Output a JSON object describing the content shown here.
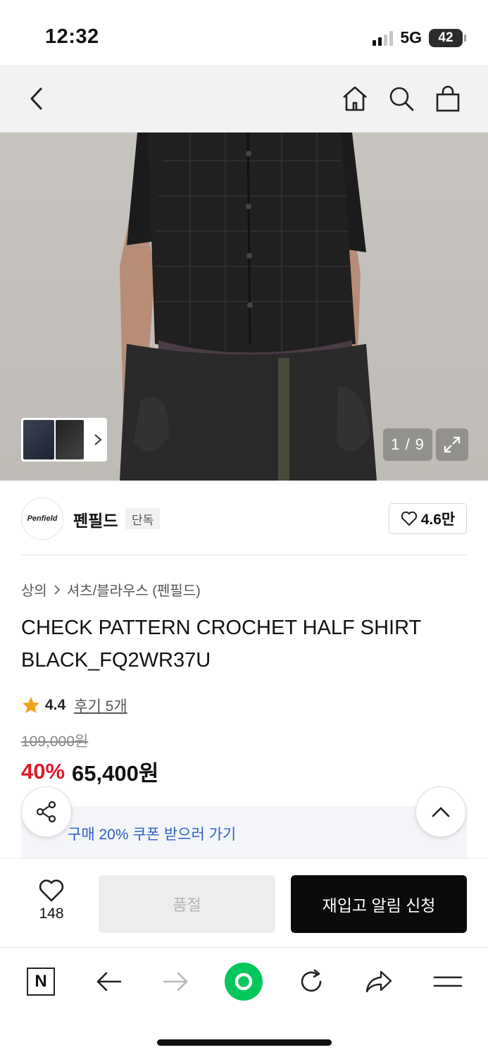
{
  "status_bar": {
    "time": "12:32",
    "network": "5G",
    "battery": "42"
  },
  "nav": {
    "back_icon": "chevron-left-icon",
    "home_icon": "home-icon",
    "search_icon": "search-icon",
    "cart_icon": "shopping-bag-icon"
  },
  "gallery": {
    "page_indicator": "1 / 9",
    "expand_icon": "expand-icon",
    "thumbnail_next_icon": "chevron-right-icon"
  },
  "brand": {
    "logo_text": "Penfield",
    "name": "펜필드",
    "badge": "단독",
    "likes": "4.6만"
  },
  "breadcrumb": {
    "category": "상의",
    "subcategory": "셔츠/블라우스 (펜필드)"
  },
  "product": {
    "title": "CHECK PATTERN CROCHET HALF SHIRT BLACK_FQ2WR37U",
    "rating": "4.4",
    "reviews": "후기 5개",
    "original_price": "109,000원",
    "discount": "40%",
    "price": "65,400원"
  },
  "coupon": {
    "text": "구매 20% 쿠폰 받으러 가기",
    "arrow": "›"
  },
  "actions": {
    "wish_count": "148",
    "soldout_label": "품절",
    "restock_label": "재입고 알림 신청"
  },
  "browser_bar": {
    "n_label": "N"
  },
  "colors": {
    "discount": "#e0192d",
    "coupon_text": "#2d5fc8",
    "primary_button": "#0b0b0b",
    "green_button": "#03c75a"
  }
}
